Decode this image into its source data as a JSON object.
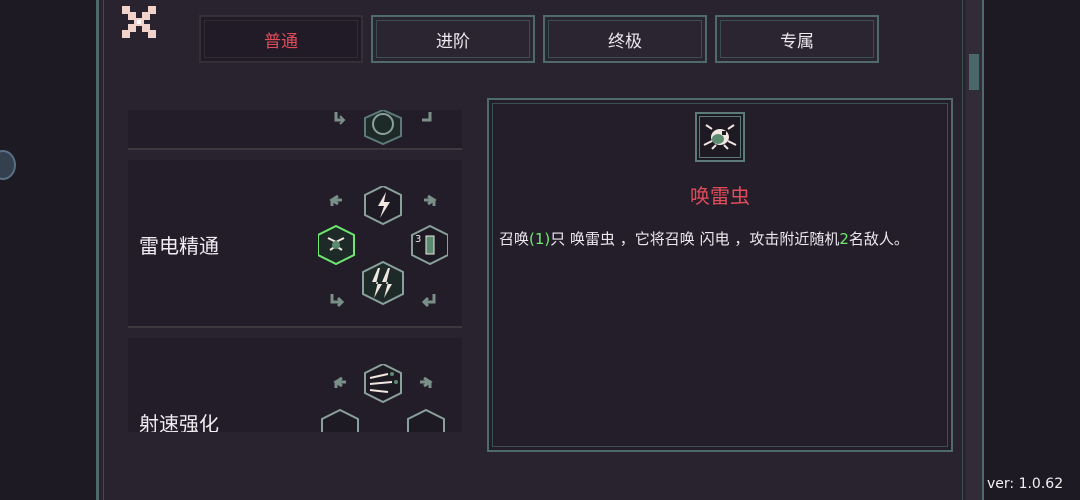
{
  "tabs": [
    {
      "label": "普通",
      "active": true
    },
    {
      "label": "进阶",
      "active": false
    },
    {
      "label": "终极",
      "active": false
    },
    {
      "label": "专属",
      "active": false
    }
  ],
  "list": {
    "items": [
      {
        "name": "雷电精通"
      },
      {
        "name": "射速强化"
      }
    ]
  },
  "detail": {
    "icon": "thunder-bug-icon",
    "title": "唤雷虫",
    "desc_before": "召唤",
    "summon_count": "(1)",
    "desc_middle": "只 唤雷虫 ，它将召唤 闪电 ，攻击附近随机",
    "target_count": "2",
    "desc_after": "名敌人。"
  },
  "version": "ver: 1.0.62",
  "colors": {
    "accent_red": "#e04b5a",
    "number_green": "#6ee86e",
    "frame_teal": "#4f6a6c",
    "background": "#29232f"
  }
}
